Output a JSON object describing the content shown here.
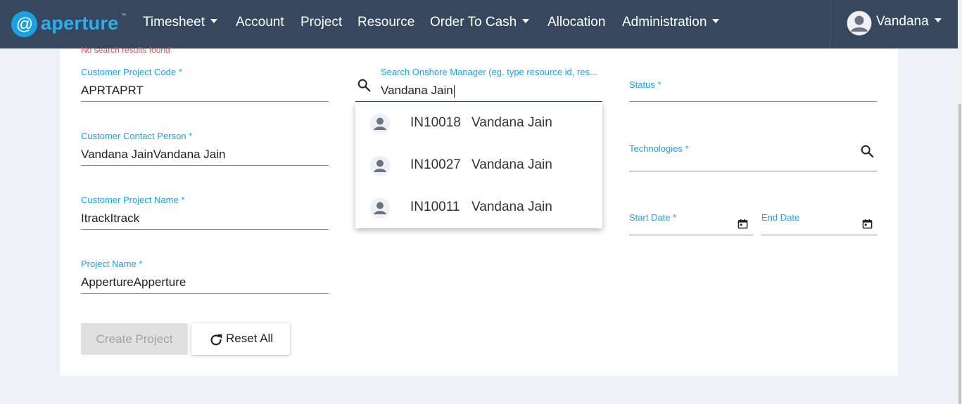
{
  "brand": {
    "logo_glyph": "@",
    "name": "aperture",
    "tm": "™"
  },
  "nav": {
    "items": [
      {
        "label": "Timesheet",
        "dropdown": true
      },
      {
        "label": "Account",
        "dropdown": false
      },
      {
        "label": "Project",
        "dropdown": false
      },
      {
        "label": "Resource",
        "dropdown": false
      },
      {
        "label": "Order To Cash",
        "dropdown": true
      },
      {
        "label": "Allocation",
        "dropdown": false
      },
      {
        "label": "Administration",
        "dropdown": true
      }
    ],
    "user": {
      "name": "Vandana"
    }
  },
  "form": {
    "no_results": "No search results found",
    "customer_project_code": {
      "label": "Customer Project Code *",
      "value": "APRTAPRT"
    },
    "customer_contact_person": {
      "label": "Customer Contact Person *",
      "value": "Vandana JainVandana Jain"
    },
    "customer_project_name": {
      "label": "Customer Project Name *",
      "value": "ItrackItrack"
    },
    "project_name": {
      "label": "Project Name *",
      "value": "AppertureApperture"
    },
    "onshore_manager": {
      "label": "Search Onshore Manager (eg. type resource id, res...",
      "value": "Vandana Jain"
    },
    "status": {
      "label": "Status *",
      "value": ""
    },
    "technologies": {
      "label": "Technologies *",
      "value": ""
    },
    "start_date": {
      "label": "Start Date *",
      "value": ""
    },
    "end_date": {
      "label": "End Date",
      "value": ""
    }
  },
  "suggestions": [
    {
      "id": "IN10018",
      "name": "Vandana Jain"
    },
    {
      "id": "IN10027",
      "name": "Vandana Jain"
    },
    {
      "id": "IN10011",
      "name": "Vandana Jain"
    }
  ],
  "buttons": {
    "create": "Create Project",
    "reset": "Reset All"
  },
  "colors": {
    "navbar": "#36475e",
    "accent": "#1aa3e8",
    "error": "#d9534f"
  }
}
